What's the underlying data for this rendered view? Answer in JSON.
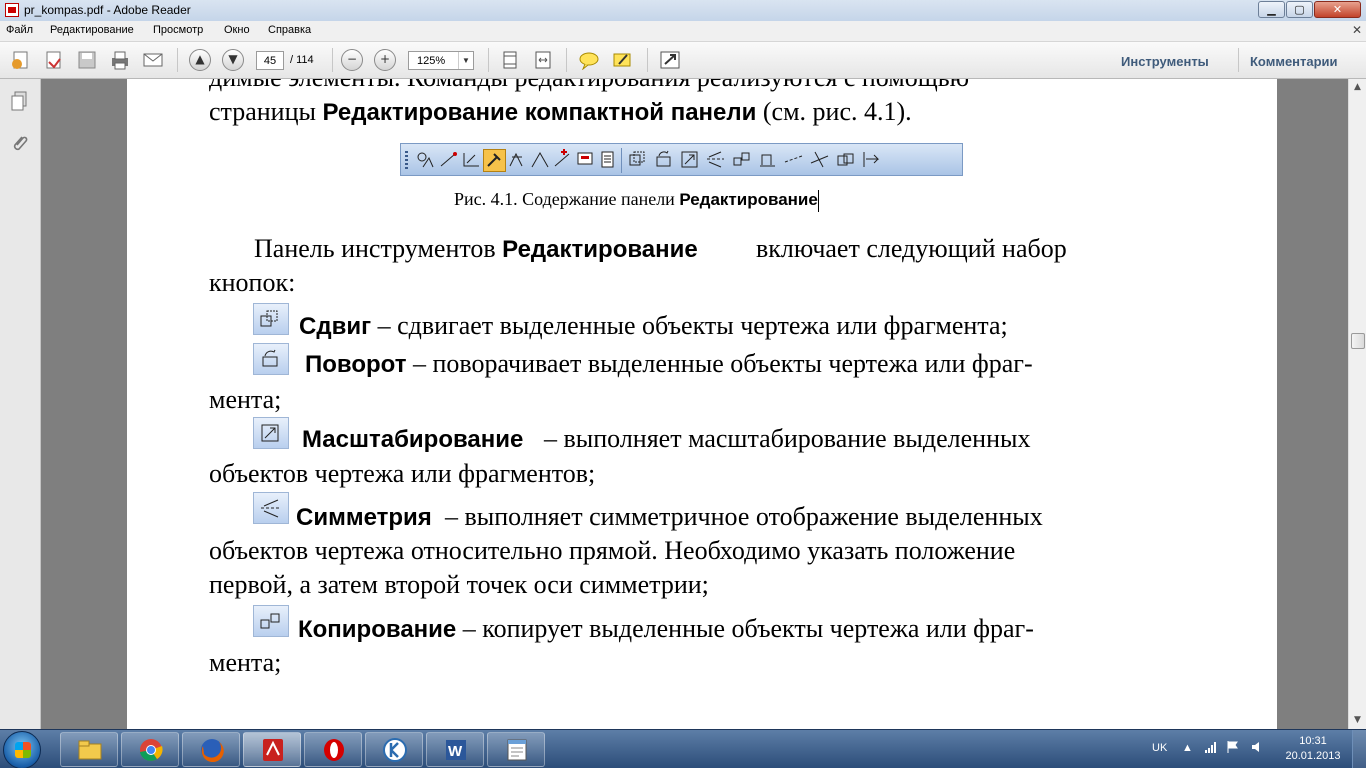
{
  "window": {
    "title": "pr_kompas.pdf - Adobe Reader"
  },
  "menu": {
    "items": [
      "Файл",
      "Редактирование",
      "Просмотр",
      "Окно",
      "Справка"
    ],
    "close_glyph": "✕"
  },
  "toolbar": {
    "page_current": "45",
    "page_total": "/ 114",
    "zoom": "125%",
    "tools_label": "Инструменты",
    "comments_label": "Комментарии"
  },
  "document": {
    "line0": "димые элементы. Команды редактирования реализуются с помощью",
    "line1_a": "страницы ",
    "line1_b": "Редактирование компактной панели",
    "line1_c": " (см. рис. 4.1).",
    "caption_a": "Рис. 4.1. Содержание панели  ",
    "caption_b": "Редактирование",
    "para_a": "Панель инструментов ",
    "para_b": "Редактирование",
    "para_c": " включает следующий набор",
    "para_d": "кнопок:",
    "items": [
      {
        "name": "Сдвиг",
        "text": " – сдвигает выделенные объекты чертежа или фрагмента;"
      },
      {
        "name": "Поворот",
        "text": " – поворачивает выделенные объекты чертежа или фраг-",
        "cont": "мента;"
      },
      {
        "name": "Масштабирование",
        "text": " – выполняет масштабирование выделенных",
        "cont": "объектов чертежа или фрагментов;"
      },
      {
        "name": "Симметрия",
        "text": " – выполняет симметричное отображение выделенных",
        "cont": "объектов чертежа относительно прямой. Необходимо указать положение",
        "cont2": "первой, а затем второй точек оси симметрии;"
      },
      {
        "name": "Копирование",
        "text": " – копирует выделенные объекты чертежа или фраг-",
        "cont": "мента;"
      }
    ]
  },
  "taskbar": {
    "lang": "UK",
    "time": "10:31",
    "date": "20.01.2013",
    "apps": [
      "explorer-icon",
      "chrome-icon",
      "firefox-icon",
      "acrobat-icon",
      "opera-icon",
      "kompas-icon",
      "word-icon",
      "notepad-icon"
    ]
  },
  "colors": {
    "accent": "#3f5b7b",
    "panel": "#aac4e6"
  }
}
